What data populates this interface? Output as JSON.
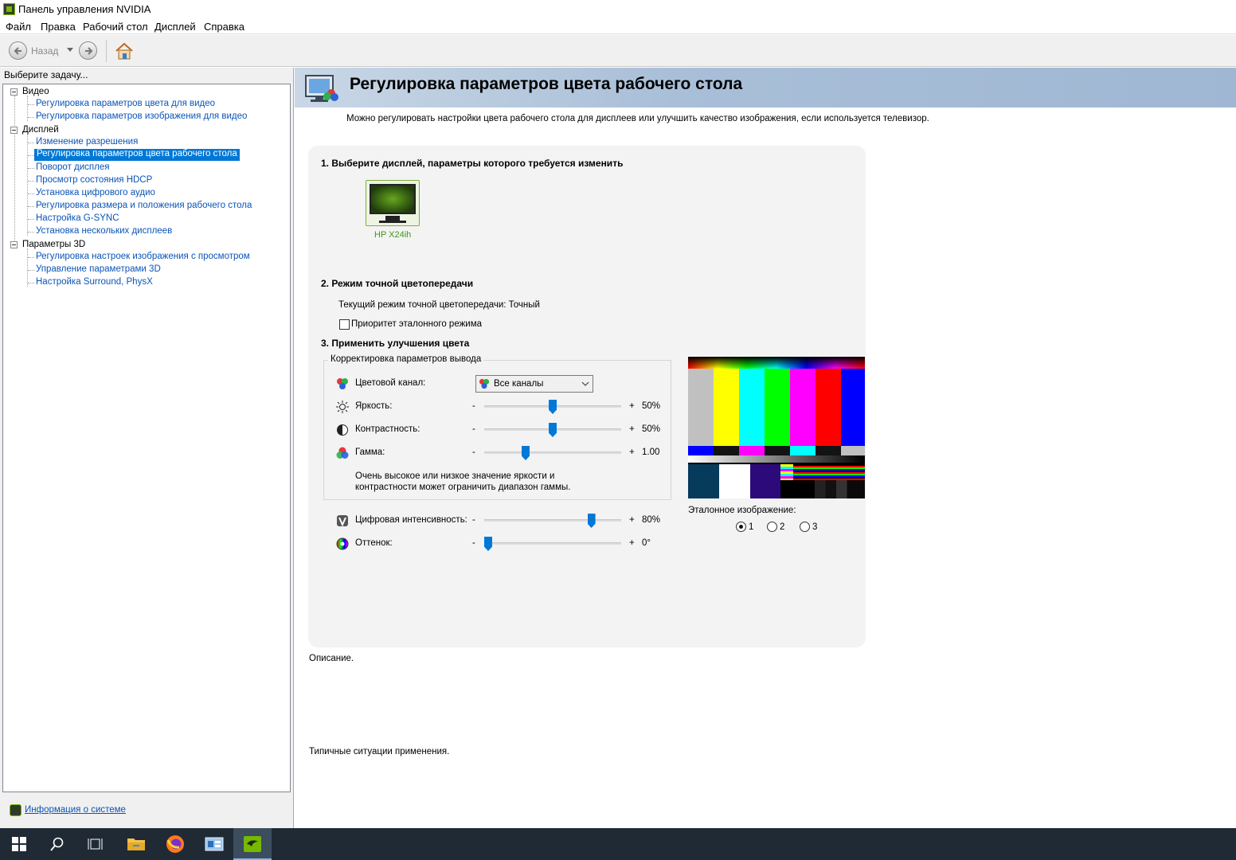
{
  "window": {
    "title": "Панель управления NVIDIA"
  },
  "menu": [
    "Файл",
    "Правка",
    "Рабочий стол",
    "Дисплей",
    "Справка"
  ],
  "toolbar": {
    "back_label": "Назад",
    "back_icon": "arrow-left-icon",
    "forward_icon": "arrow-right-icon",
    "home_icon": "home-icon"
  },
  "sidebar": {
    "header": "Выберите задачу...",
    "categories": [
      {
        "label": "Видео",
        "items": [
          "Регулировка параметров цвета для видео",
          "Регулировка параметров изображения для видео"
        ]
      },
      {
        "label": "Дисплей",
        "items": [
          "Изменение разрешения",
          "Регулировка параметров цвета рабочего стола",
          "Поворот дисплея",
          "Просмотр состояния HDCP",
          "Установка цифрового аудио",
          "Регулировка размера и положения рабочего стола",
          "Настройка G-SYNC",
          "Установка нескольких дисплеев"
        ]
      },
      {
        "label": "Параметры 3D",
        "items": [
          "Регулировка настроек изображения с просмотром",
          "Управление параметрами 3D",
          "Настройка Surround, PhysX"
        ]
      }
    ],
    "selected": "Регулировка параметров цвета рабочего стола",
    "system_info": "Информация о системе"
  },
  "page": {
    "title": "Регулировка параметров цвета рабочего стола",
    "subtitle": "Можно регулировать настройки цвета рабочего стола для дисплеев или улучшить качество изображения, если используется телевизор.",
    "section1": "1. Выберите дисплей, параметры которого требуется изменить",
    "display_name": "HP X24ih",
    "section2": "2. Режим точной цветопередачи",
    "current_mode": "Текущий режим точной цветопередачи: Точный",
    "reference_priority": "Приоритет эталонного режима",
    "section3": "3. Применить улучшения цвета",
    "group_label": "Корректировка параметров вывода",
    "channel_label": "Цветовой канал:",
    "channel_value": "Все каналы",
    "brightness": {
      "label": "Яркость:",
      "minus": "-",
      "plus": "+",
      "value": "50%",
      "fraction": 0.5
    },
    "contrast": {
      "label": "Контрастность:",
      "minus": "-",
      "plus": "+",
      "value": "50%",
      "fraction": 0.5
    },
    "gamma": {
      "label": "Гамма:",
      "minus": "-",
      "plus": "+",
      "value": "1.00",
      "fraction": 0.29
    },
    "warning": [
      "Очень высокое или низкое значение яркости и",
      "контрастности может ограничить диапазон гаммы."
    ],
    "vibrance": {
      "label": "Цифровая интенсивность:",
      "minus": "-",
      "plus": "+",
      "value": "80%",
      "fraction": 0.8
    },
    "hue": {
      "label": "Оттенок:",
      "minus": "-",
      "plus": "+",
      "value": "0°",
      "fraction": 0.0
    },
    "reference_image_label": "Эталонное изображение:",
    "reference_options": [
      "1",
      "2",
      "3"
    ],
    "reference_selected": "1",
    "description_label": "Описание.",
    "usage_label": "Типичные ситуации применения."
  },
  "colors": {
    "accent": "#0078d7",
    "nvidia_green": "#76b900",
    "link": "#0a54b8"
  }
}
